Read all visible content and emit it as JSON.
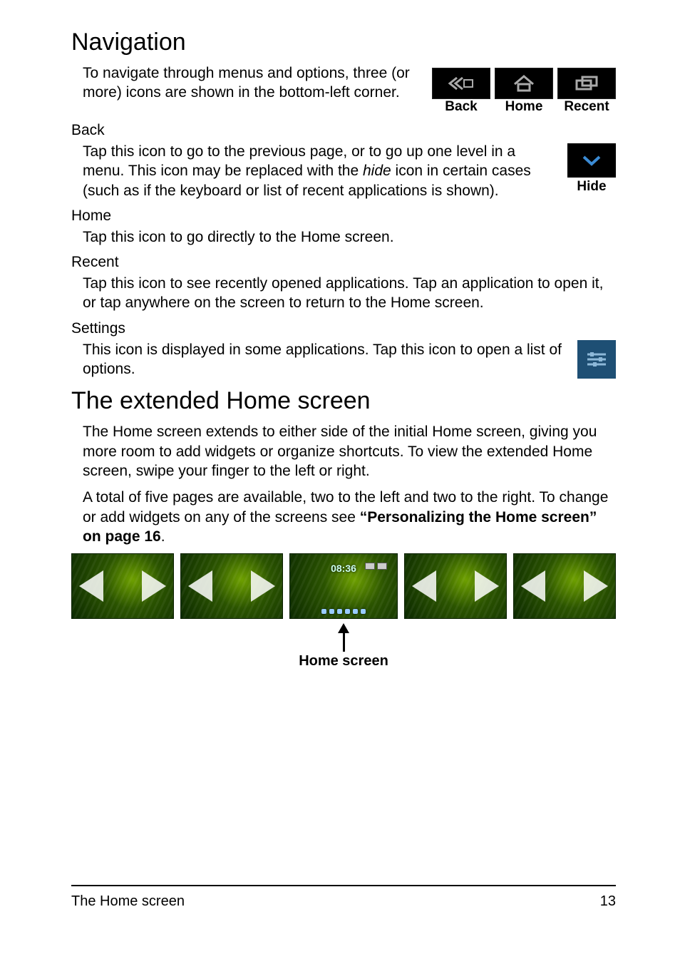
{
  "headings": {
    "navigation": "Navigation",
    "extended": "The extended Home screen"
  },
  "nav_intro": "To navigate through menus and options, three (or more) icons are shown in the bottom-left corner.",
  "nav_icons": {
    "back": "Back",
    "home": "Home",
    "recent": "Recent",
    "hide": "Hide"
  },
  "back": {
    "title": "Back",
    "body_pre": "Tap this icon to go to the previous page, or to go up one level in a menu. This icon may be replaced with the ",
    "body_italic": "hide",
    "body_post": " icon in certain cases (such as if the keyboard or list of recent applications is shown)."
  },
  "home": {
    "title": "Home",
    "body": "Tap this icon to go directly to the Home screen."
  },
  "recent": {
    "title": "Recent",
    "body": "Tap this icon to see recently opened applications. Tap an application to open it, or tap anywhere on the screen to return to the Home screen."
  },
  "settings": {
    "title": "Settings",
    "body": "This icon is displayed in some applications. Tap this icon to open a list of options."
  },
  "extended": {
    "p1": "The Home screen extends to either side of the initial Home screen, giving you more room to add widgets or organize shortcuts. To view the extended Home screen, swipe your finger to the left or right.",
    "p2_pre": "A total of five pages are available, two to the left and two to the right. To change or add widgets on any of the screens see ",
    "p2_bold": "“Personalizing the Home screen” on page 16",
    "p2_post": ".",
    "clock": "08:36",
    "arrow_label": "Home screen"
  },
  "footer": {
    "title": "The Home screen",
    "page": "13"
  }
}
